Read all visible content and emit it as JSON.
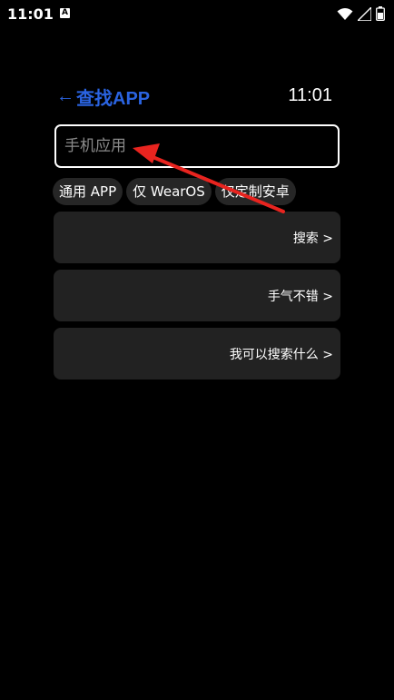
{
  "status_bar": {
    "time": "11:01",
    "notification_icon": "A",
    "icons": [
      "wifi-icon",
      "signal-icon",
      "battery-icon"
    ]
  },
  "header": {
    "back_arrow": "←",
    "title": "查找APP",
    "clock": "11:01"
  },
  "search": {
    "placeholder": "手机应用",
    "value": ""
  },
  "filters": [
    {
      "label": "通用 APP"
    },
    {
      "label": "仅 WearOS"
    },
    {
      "label": "仅定制安卓"
    }
  ],
  "actions": [
    {
      "label": "搜索 >"
    },
    {
      "label": "手气不错 >"
    },
    {
      "label": "我可以搜索什么 >"
    }
  ],
  "colors": {
    "background": "#000000",
    "accent": "#2a63e0",
    "card": "#222222",
    "chip": "#262626",
    "annotation_arrow": "#e8241f"
  }
}
